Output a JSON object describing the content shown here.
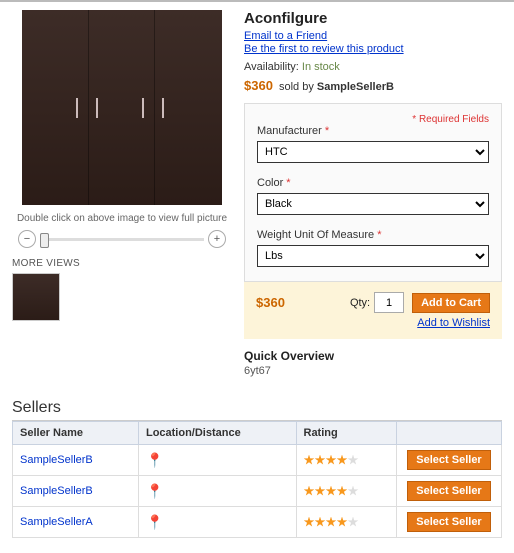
{
  "product": {
    "title": "Aconfilgure",
    "email_friend": "Email to a Friend",
    "first_review": "Be the first to review this product",
    "availability_label": "Availability:",
    "availability_value": "In stock",
    "price": "$360",
    "sold_by_prefix": "sold by",
    "sold_by_seller": "SampleSellerB",
    "image_caption": "Double click on above image to view full picture",
    "more_views": "MORE VIEWS"
  },
  "options": {
    "required_fields": "* Required Fields",
    "manufacturer_label": "Manufacturer",
    "manufacturer_value": "HTC",
    "color_label": "Color",
    "color_value": "Black",
    "weight_uom_label": "Weight Unit Of Measure",
    "weight_uom_value": "Lbs"
  },
  "cart": {
    "price": "$360",
    "qty_label": "Qty:",
    "qty_value": "1",
    "add_to_cart": "Add to Cart",
    "add_to_wishlist": "Add to Wishlist"
  },
  "overview": {
    "heading": "Quick Overview",
    "text": "6yt67"
  },
  "sellers": {
    "heading": "Sellers",
    "col_name": "Seller Name",
    "col_location": "Location/Distance",
    "col_rating": "Rating",
    "select_label": "Select Seller",
    "rows": [
      {
        "name": "SampleSellerB",
        "rating": 4
      },
      {
        "name": "SampleSellerB",
        "rating": 4
      },
      {
        "name": "SampleSellerA",
        "rating": 4
      }
    ]
  }
}
